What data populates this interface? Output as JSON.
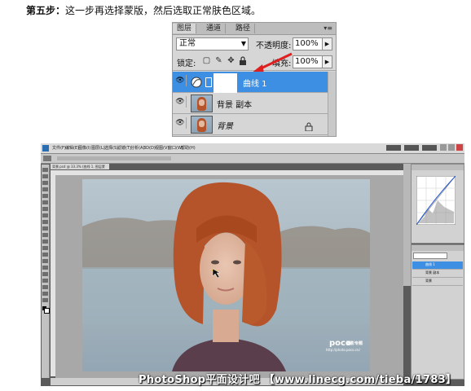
{
  "step": {
    "label": "第五步：",
    "text": "这一步再选择蒙版，然后选取正常肤色区域。"
  },
  "layers_panel": {
    "tabs": [
      "图层",
      "通道",
      "路径"
    ],
    "menu_glyph": "▾≡",
    "blend_mode": "正常",
    "opacity_label": "不透明度:",
    "opacity_value": "100%",
    "lock_label": "锁定:",
    "fill_label": "填充:",
    "fill_value": "100%",
    "layers": [
      {
        "name": "曲线 1",
        "selected": true
      },
      {
        "name": "背景 副本",
        "selected": false
      },
      {
        "name": "背景",
        "selected": false
      }
    ]
  },
  "photoshop": {
    "menu": [
      "文件(F)",
      "编辑(E)",
      "图像(I)",
      "图层(L)",
      "选择(S)",
      "滤镜(T)",
      "分析(A)",
      "3D(D)",
      "视图(V)",
      "窗口(W)",
      "帮助(H)"
    ],
    "doc_tab": "背景.psd @ 33.3% (曲线 1, 图层蒙版/8) *",
    "photo_watermark": "poco",
    "photo_watermark_sub": "摄影专题",
    "photo_watermark_url": "http://photo.poco.cn/",
    "mini_layers": [
      "曲线 1",
      "背景 副本",
      "背景"
    ]
  },
  "watermark": "PhotoShop平面设计吧 【www.linecg.com/tieba/1783】",
  "colors": {
    "selected": "#3d8fe3",
    "panel_bg": "#d6d6d6",
    "arrow": "#e02020",
    "hair": "#b5542a"
  }
}
